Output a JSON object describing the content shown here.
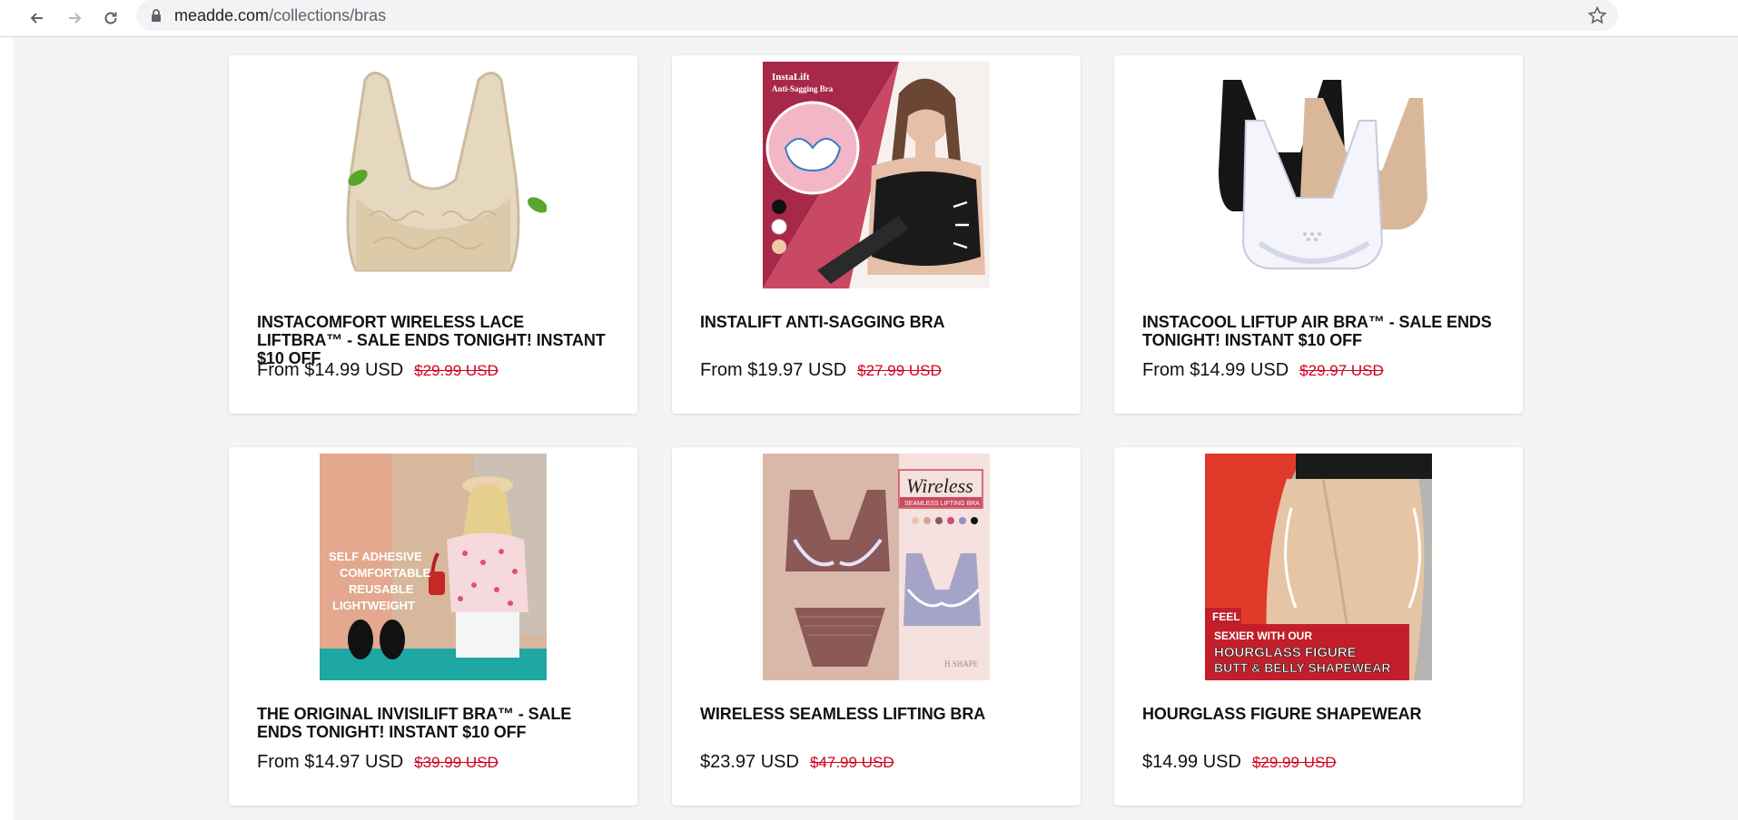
{
  "browser": {
    "url_host": "meadde.com",
    "url_path": "/collections/bras",
    "icons": [
      "back-arrow-icon",
      "forward-arrow-icon",
      "reload-icon",
      "lock-icon",
      "bookmark-star-icon"
    ]
  },
  "colors": {
    "page_bg": "#f3f4f6",
    "sale_red": "#d0021b",
    "text": "#111111"
  },
  "products": [
    {
      "title": "INSTACOMFORT WIRELESS LACE LIFTBRA™ - SALE ENDS TONIGHT! INSTANT $10 OFF",
      "price": "From $14.99 USD",
      "compare_price": "$29.99 USD"
    },
    {
      "title": "INSTALIFT ANTI-SAGGING BRA",
      "price": "From $19.97 USD",
      "compare_price": "$27.99 USD",
      "image_text": [
        "InstaLift",
        "Anti-Sagging Bra"
      ]
    },
    {
      "title": "INSTACOOL LIFTUP AIR BRA™ - SALE ENDS TONIGHT! INSTANT $10 OFF",
      "price": "From $14.99 USD",
      "compare_price": "$29.97 USD"
    },
    {
      "title": "THE ORIGINAL INVISILIFT BRA™ - SALE ENDS TONIGHT! INSTANT $10 OFF",
      "price": "From $14.97 USD",
      "compare_price": "$39.99 USD",
      "image_text": [
        "SELF ADHESIVE",
        "COMFORTABLE",
        "REUSABLE",
        "LIGHTWEIGHT"
      ]
    },
    {
      "title": "WIRELESS SEAMLESS LIFTING BRA",
      "price": "$23.97 USD",
      "compare_price": "$47.99 USD",
      "image_text": [
        "Wireless",
        "SEAMLESS LIFTING BRA"
      ]
    },
    {
      "title": "HOURGLASS FIGURE SHAPEWEAR",
      "price": "$14.99 USD",
      "compare_price": "$29.99 USD",
      "image_text": [
        "FEEL",
        "SEXIER WITH OUR",
        "HOURGLASS FIGURE",
        "BUTT & BELLY SHAPEWEAR"
      ]
    }
  ]
}
